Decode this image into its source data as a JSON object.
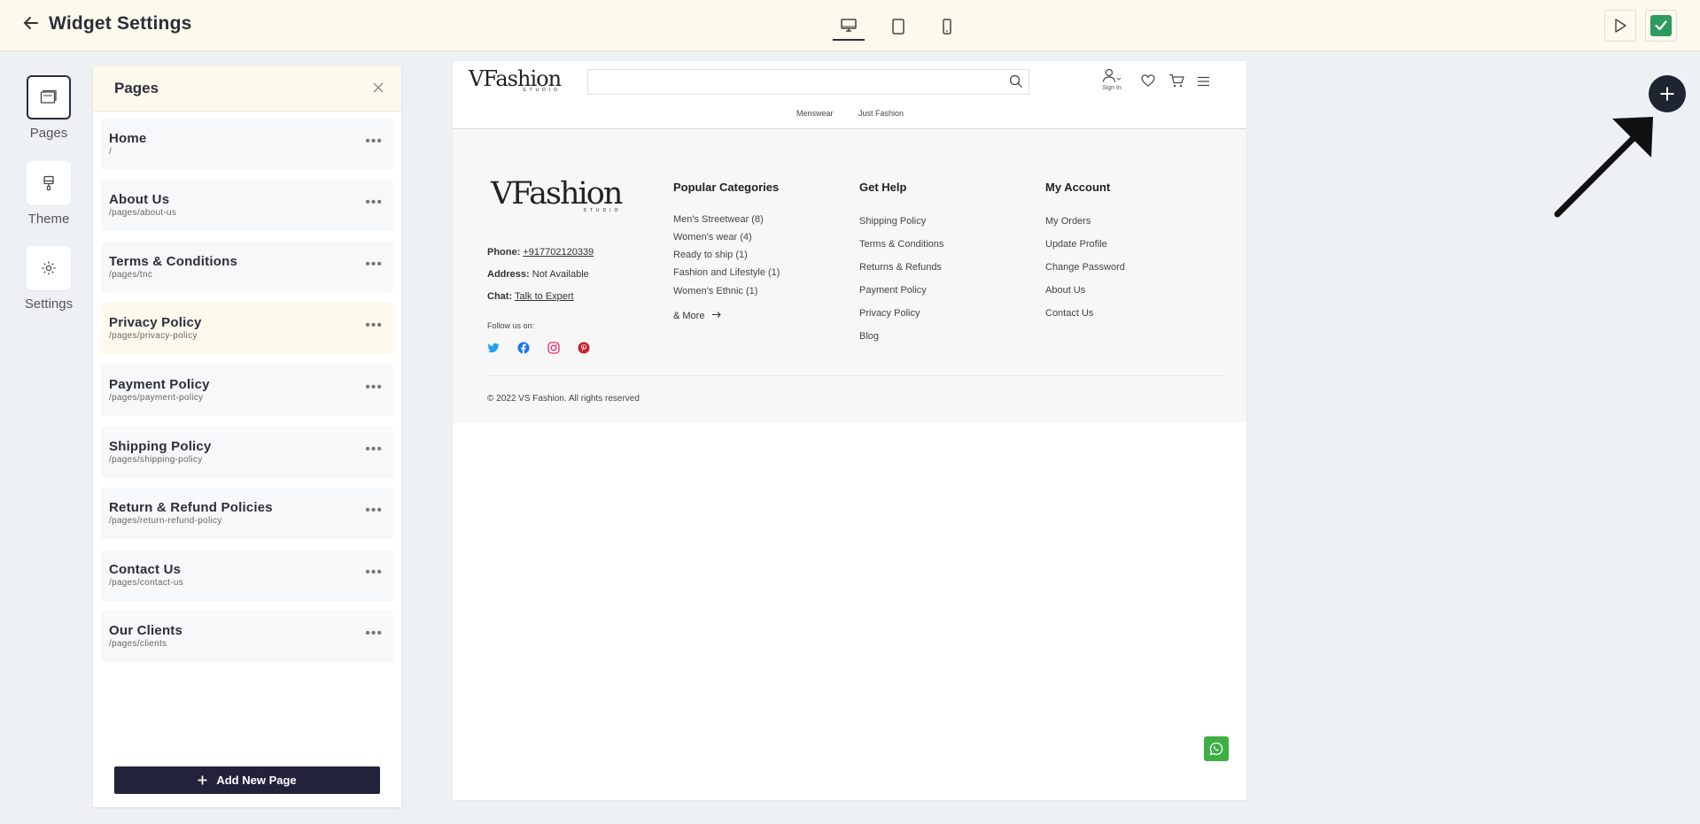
{
  "header": {
    "title": "Widget Settings",
    "devices": [
      "desktop",
      "tablet",
      "mobile"
    ],
    "active_device": "desktop"
  },
  "rail": {
    "items": [
      {
        "label": "Pages",
        "icon": "pages-icon",
        "active": true
      },
      {
        "label": "Theme",
        "icon": "paint-brush-icon",
        "active": false
      },
      {
        "label": "Settings",
        "icon": "gear-icon",
        "active": false
      }
    ]
  },
  "pages_panel": {
    "title": "Pages",
    "items": [
      {
        "name": "Home",
        "slug": "/"
      },
      {
        "name": "About Us",
        "slug": "/pages/about-us"
      },
      {
        "name": "Terms & Conditions",
        "slug": "/pages/tnc"
      },
      {
        "name": "Privacy Policy",
        "slug": "/pages/privacy-policy"
      },
      {
        "name": "Payment Policy",
        "slug": "/pages/payment-policy"
      },
      {
        "name": "Shipping Policy",
        "slug": "/pages/shipping-policy"
      },
      {
        "name": "Return & Refund Policies",
        "slug": "/pages/return-refund-policy"
      },
      {
        "name": "Contact Us",
        "slug": "/pages/contact-us"
      },
      {
        "name": "Our Clients",
        "slug": "/pages/clients"
      }
    ],
    "highlighted": "Privacy Policy",
    "add_button": "Add New Page"
  },
  "site": {
    "logo": "VFashion",
    "logo_sub": "STUDIO",
    "signin": "Sign In",
    "nav": [
      "Menswear",
      "Just Fashion"
    ],
    "contact": {
      "phone_label": "Phone:",
      "phone": "+917702120339",
      "address_label": "Address:",
      "address": "Not Available",
      "chat_label": "Chat:",
      "chat": "Talk to Expert"
    },
    "follow": "Follow us on:",
    "columns": [
      {
        "title": "Popular Categories",
        "links": [
          "Men's Streetwear (8)",
          "Women's wear (4)",
          "Ready to ship (1)",
          "Fashion and Lifestyle (1)",
          "Women's Ethnic (1)"
        ]
      },
      {
        "title": "Get Help",
        "links": [
          "Shipping Policy",
          "Terms & Conditions",
          "Returns & Refunds",
          "Payment Policy",
          "Privacy Policy",
          "Blog"
        ]
      },
      {
        "title": "My Account",
        "links": [
          "My Orders",
          "Update Profile",
          "Change Password",
          "About Us",
          "Contact Us"
        ]
      }
    ],
    "more": "& More",
    "copyright": "© 2022 VS Fashion. All rights reserved"
  },
  "colors": {
    "accent_dark": "#22223a",
    "topbar_bg": "#fdf9ec",
    "save_green": "#2e9a5f",
    "whatsapp_green": "#3cb043"
  }
}
